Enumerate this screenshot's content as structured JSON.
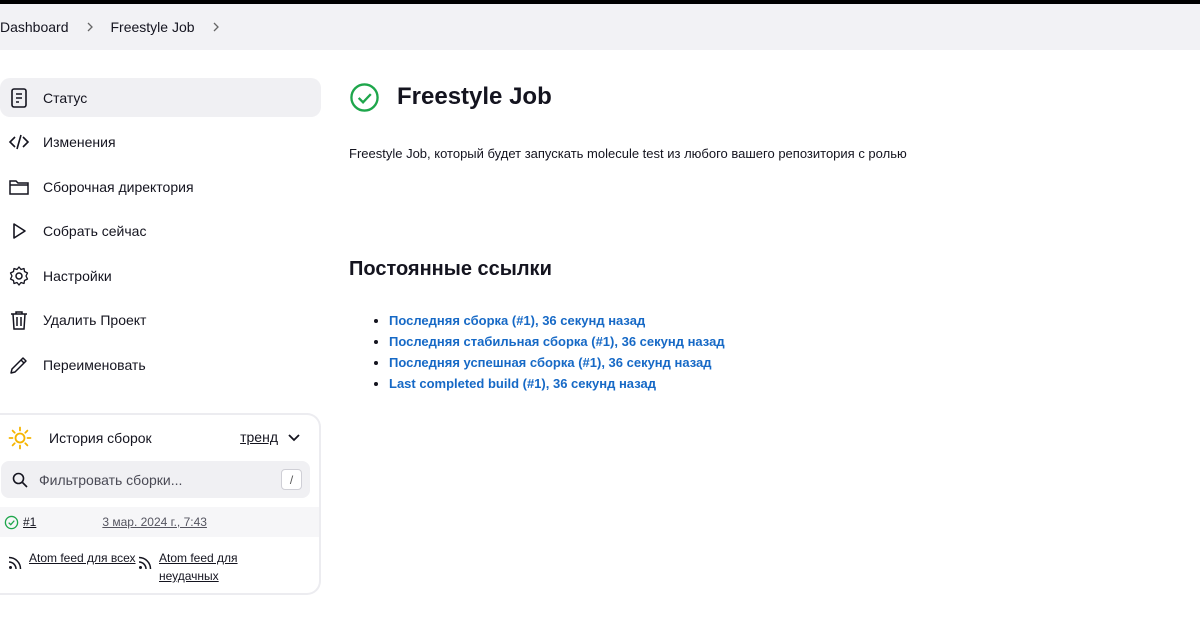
{
  "breadcrumb": {
    "items": [
      "Dashboard",
      "Freestyle Job"
    ]
  },
  "sidebar": {
    "items": [
      {
        "label": "Статус",
        "icon": "document-icon"
      },
      {
        "label": "Изменения",
        "icon": "code-icon"
      },
      {
        "label": "Сборочная директория",
        "icon": "folder-icon"
      },
      {
        "label": "Собрать сейчас",
        "icon": "play-icon"
      },
      {
        "label": "Настройки",
        "icon": "gear-icon"
      },
      {
        "label": "Удалить Проект",
        "icon": "trash-icon"
      },
      {
        "label": "Переименовать",
        "icon": "pencil-icon"
      }
    ]
  },
  "history": {
    "title": "История сборок",
    "trend": "тренд",
    "search_placeholder": "Фильтровать сборки...",
    "shortcut": "/",
    "builds": [
      {
        "number": "#1",
        "date": "3 мар. 2024 г., 7:43",
        "status": "success"
      }
    ],
    "feeds": [
      "Atom feed для всех",
      "Atom feed для неудачных"
    ]
  },
  "main": {
    "title": "Freestyle Job",
    "description": "Freestyle Job, который будет запускать molecule test из любого вашего репозитория с ролью",
    "permalinks_title": "Постоянные ссылки",
    "permalinks": [
      "Последняя сборка (#1), 36 секунд назад",
      "Последняя стабильная сборка (#1), 36 секунд назад",
      "Последняя успешная сборка (#1), 36 секунд назад",
      "Last completed build (#1), 36 секунд назад"
    ]
  },
  "colors": {
    "success": "#1ea64b",
    "link": "#1669c6",
    "sun": "#f5b400"
  }
}
